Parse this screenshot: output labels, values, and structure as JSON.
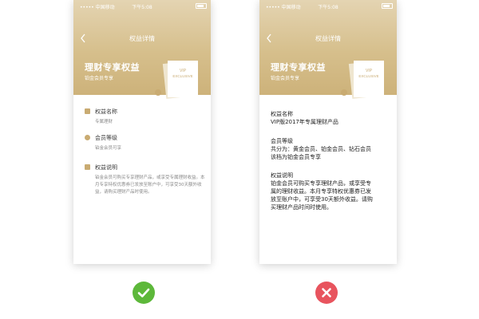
{
  "status_bar": {
    "carrier": "••••• 中国移动",
    "time": "下午5:08"
  },
  "nav": {
    "title": "权益详情"
  },
  "hero": {
    "title": "理财专享权益",
    "subtitle": "铂金会员专享",
    "card_text_line1": "VIP",
    "card_text_line2": "EXCLUSIVE"
  },
  "left_items": [
    {
      "title": "权益名称",
      "desc": "专属理财"
    },
    {
      "title": "会员等级",
      "desc": "铂金会员可享"
    },
    {
      "title": "权益说明",
      "desc": "铂金会员可购买专享理财产品，或享受专属理财收益。本月专享特权优惠券已发放至账户中，可享受30天额外收益，请购买理财产品时使用。"
    }
  ],
  "right_blocks": [
    {
      "title": "权益名称",
      "lines": [
        "VIP版2017年专属理财产品"
      ]
    },
    {
      "title": "会员等级",
      "lines": [
        "共分为：黄金会员、铂金会员、钻石会员",
        "该档为铂金会员专享"
      ]
    },
    {
      "title": "权益说明",
      "lines": [
        "铂金会员可购买专享理财产品，或享受专",
        "属的理财收益。本月专享特权优惠券已发",
        "放至账户中，可享受30天额外收益。请购",
        "买理财产品时间时使用。"
      ]
    }
  ],
  "colors": {
    "gold": "#c9ab72",
    "correct": "#5db83a",
    "wrong": "#e8545e"
  },
  "icons": {
    "correct": "check-icon",
    "wrong": "x-icon"
  }
}
